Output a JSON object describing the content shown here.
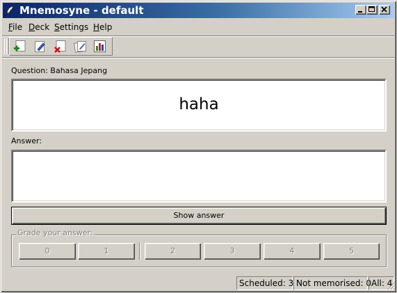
{
  "window": {
    "title": "Mnemosyne - default",
    "controls": {
      "minimize": "minimize",
      "maximize": "maximize",
      "close": "close"
    }
  },
  "menu": {
    "items": [
      {
        "label": "File",
        "accel": "F",
        "rest": "ile"
      },
      {
        "label": "Deck",
        "accel": "D",
        "rest": "eck"
      },
      {
        "label": "Settings",
        "accel": "S",
        "rest": "ettings"
      },
      {
        "label": "Help",
        "accel": "H",
        "rest": "elp"
      }
    ]
  },
  "toolbar": {
    "icons": [
      "add-cards-icon",
      "edit-card-icon",
      "delete-card-icon",
      "edit-deck-icon",
      "statistics-icon"
    ]
  },
  "question": {
    "label": "Question: Bahasa Jepang",
    "text": "haha"
  },
  "answer": {
    "label": "Answer:",
    "text": ""
  },
  "show_answer": {
    "label": "Show answer"
  },
  "grading": {
    "legend": "Grade your answer:",
    "grades": [
      "0",
      "1",
      "2",
      "3",
      "4",
      "5"
    ]
  },
  "status": {
    "scheduled": "Scheduled: 3",
    "not_memorised": "Not memorised: 0",
    "all": "All: 4"
  },
  "colors": {
    "titlebar_start": "#0a246a",
    "titlebar_end": "#a6caf0",
    "face": "#d4d0c8"
  }
}
